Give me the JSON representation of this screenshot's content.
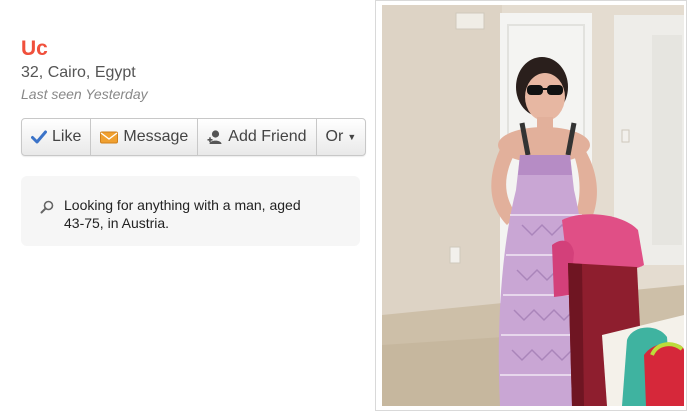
{
  "profile": {
    "name": "Uc",
    "details": "32, Cairo, Egypt",
    "last_seen": "Last seen Yesterday"
  },
  "actions": {
    "like": "Like",
    "message": "Message",
    "add_friend": "Add Friend",
    "or": "Or"
  },
  "looking_for": "Looking for anything with a man, aged 43-75, in Austria.",
  "colors": {
    "name": "#f0503c",
    "like_check": "#3b73c8",
    "message_envelope": "#f0a030"
  }
}
